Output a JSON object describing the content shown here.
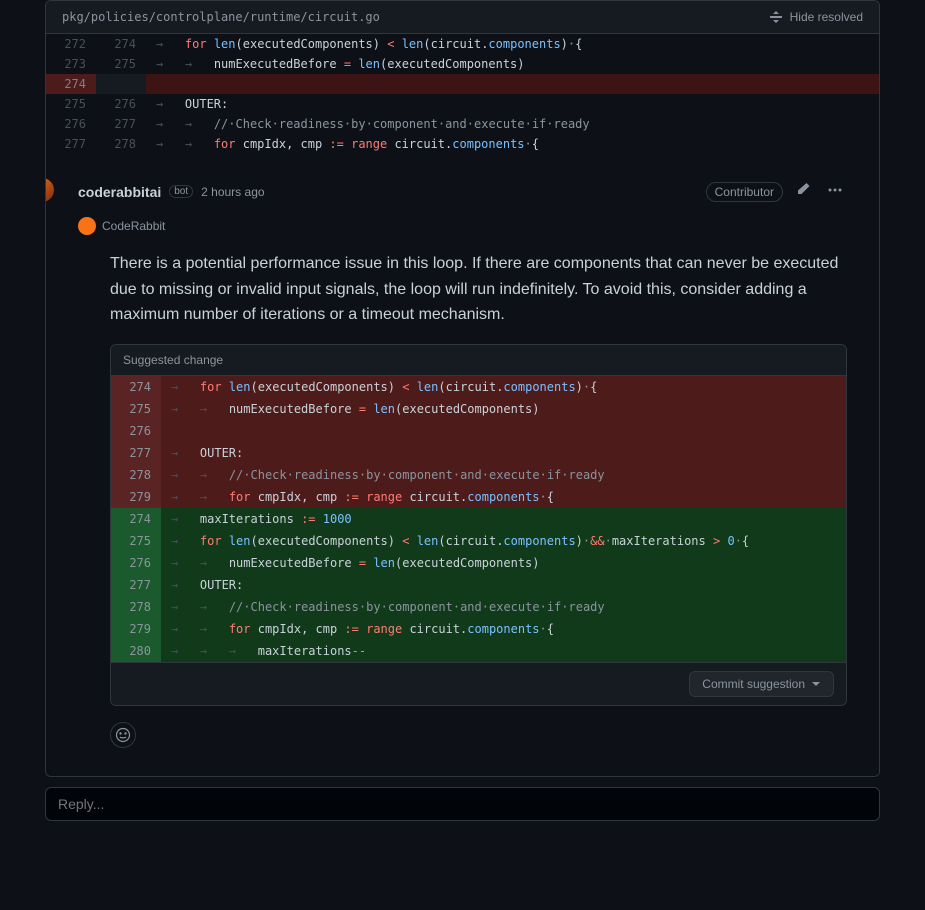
{
  "file": {
    "path": "pkg/policies/controlplane/runtime/circuit.go"
  },
  "header": {
    "hide_resolved": "Hide resolved"
  },
  "diff": [
    {
      "old": "272",
      "new": "274",
      "tokens": [
        [
          "arrow",
          "→   "
        ],
        [
          "kw",
          "for"
        ],
        [
          "",
          " "
        ],
        [
          "fn",
          "len"
        ],
        [
          "",
          "(executedComponents) "
        ],
        [
          "op",
          "<"
        ],
        [
          "",
          " "
        ],
        [
          "fn",
          "len"
        ],
        [
          "",
          "(circuit."
        ],
        [
          "field",
          "components"
        ],
        [
          "",
          ")"
        ],
        [
          "dot",
          "·"
        ],
        [
          "",
          "{"
        ]
      ]
    },
    {
      "old": "273",
      "new": "275",
      "tokens": [
        [
          "arrow",
          "→   "
        ],
        [
          "arrow",
          "→   "
        ],
        [
          "",
          "numExecutedBefore "
        ],
        [
          "op",
          "="
        ],
        [
          "",
          " "
        ],
        [
          "fn",
          "len"
        ],
        [
          "",
          "(executedComponents)"
        ]
      ]
    },
    {
      "old": "274",
      "new": "",
      "deleted": true,
      "tokens": []
    },
    {
      "old": "275",
      "new": "276",
      "tokens": [
        [
          "arrow",
          "→   "
        ],
        [
          "",
          "OUTER:"
        ]
      ]
    },
    {
      "old": "276",
      "new": "277",
      "tokens": [
        [
          "arrow",
          "→   "
        ],
        [
          "arrow",
          "→   "
        ],
        [
          "comment",
          "//"
        ],
        [
          "dot",
          "·"
        ],
        [
          "comment",
          "Check"
        ],
        [
          "dot",
          "·"
        ],
        [
          "comment",
          "readiness"
        ],
        [
          "dot",
          "·"
        ],
        [
          "comment",
          "by"
        ],
        [
          "dot",
          "·"
        ],
        [
          "comment",
          "component"
        ],
        [
          "dot",
          "·"
        ],
        [
          "comment",
          "and"
        ],
        [
          "dot",
          "·"
        ],
        [
          "comment",
          "execute"
        ],
        [
          "dot",
          "·"
        ],
        [
          "comment",
          "if"
        ],
        [
          "dot",
          "·"
        ],
        [
          "comment",
          "ready"
        ]
      ]
    },
    {
      "old": "277",
      "new": "278",
      "tokens": [
        [
          "arrow",
          "→   "
        ],
        [
          "arrow",
          "→   "
        ],
        [
          "kw",
          "for"
        ],
        [
          "",
          " cmpIdx, cmp "
        ],
        [
          "op",
          ":="
        ],
        [
          "",
          " "
        ],
        [
          "kw",
          "range"
        ],
        [
          "",
          " circuit."
        ],
        [
          "field",
          "components"
        ],
        [
          "dot",
          "·"
        ],
        [
          "",
          "{"
        ]
      ]
    }
  ],
  "comment": {
    "author": "coderabbitai",
    "bot_label": "bot",
    "time": "2 hours ago",
    "contributor": "Contributor",
    "brand": "CodeRabbit",
    "text": "There is a potential performance issue in this loop. If there are components that can never be executed due to missing or invalid input signals, the loop will run indefinitely. To avoid this, consider adding a maximum number of iterations or a timeout mechanism."
  },
  "suggestion": {
    "title": "Suggested change",
    "commit_label": "Commit suggestion",
    "del": [
      {
        "ln": "274",
        "tokens": [
          [
            "arrow",
            "→   "
          ],
          [
            "kw",
            "for"
          ],
          [
            "",
            " "
          ],
          [
            "fn",
            "len"
          ],
          [
            "",
            "(executedComponents) "
          ],
          [
            "op",
            "<"
          ],
          [
            "",
            " "
          ],
          [
            "fn",
            "len"
          ],
          [
            "",
            "(circuit."
          ],
          [
            "field",
            "components"
          ],
          [
            "",
            ")"
          ],
          [
            "dot",
            "·"
          ],
          [
            "",
            "{"
          ]
        ]
      },
      {
        "ln": "275",
        "tokens": [
          [
            "arrow",
            "→   "
          ],
          [
            "arrow",
            "→   "
          ],
          [
            "",
            "numExecutedBefore "
          ],
          [
            "op",
            "="
          ],
          [
            "",
            " "
          ],
          [
            "fn",
            "len"
          ],
          [
            "",
            "(executedComponents)"
          ]
        ]
      },
      {
        "ln": "276",
        "tokens": []
      },
      {
        "ln": "277",
        "tokens": [
          [
            "arrow",
            "→   "
          ],
          [
            "",
            "OUTER:"
          ]
        ]
      },
      {
        "ln": "278",
        "tokens": [
          [
            "arrow",
            "→   "
          ],
          [
            "arrow",
            "→   "
          ],
          [
            "comment",
            "//"
          ],
          [
            "dot",
            "·"
          ],
          [
            "comment",
            "Check"
          ],
          [
            "dot",
            "·"
          ],
          [
            "comment",
            "readiness"
          ],
          [
            "dot",
            "·"
          ],
          [
            "comment",
            "by"
          ],
          [
            "dot",
            "·"
          ],
          [
            "comment",
            "component"
          ],
          [
            "dot",
            "·"
          ],
          [
            "comment",
            "and"
          ],
          [
            "dot",
            "·"
          ],
          [
            "comment",
            "execute"
          ],
          [
            "dot",
            "·"
          ],
          [
            "comment",
            "if"
          ],
          [
            "dot",
            "·"
          ],
          [
            "comment",
            "ready"
          ]
        ]
      },
      {
        "ln": "279",
        "tokens": [
          [
            "arrow",
            "→   "
          ],
          [
            "arrow",
            "→   "
          ],
          [
            "kw",
            "for"
          ],
          [
            "",
            " cmpIdx, cmp "
          ],
          [
            "op",
            ":="
          ],
          [
            "",
            " "
          ],
          [
            "kw",
            "range"
          ],
          [
            "",
            " circuit."
          ],
          [
            "field",
            "components"
          ],
          [
            "dot",
            "·"
          ],
          [
            "",
            "{"
          ]
        ]
      }
    ],
    "add": [
      {
        "ln": "274",
        "tokens": [
          [
            "arrow",
            "→   "
          ],
          [
            "",
            "maxIterations "
          ],
          [
            "op",
            ":="
          ],
          [
            "",
            " "
          ],
          [
            "num",
            "1000"
          ]
        ]
      },
      {
        "ln": "275",
        "tokens": [
          [
            "arrow",
            "→   "
          ],
          [
            "kw",
            "for"
          ],
          [
            "",
            " "
          ],
          [
            "fn",
            "len"
          ],
          [
            "",
            "(executedComponents) "
          ],
          [
            "op",
            "<"
          ],
          [
            "",
            " "
          ],
          [
            "fn",
            "len"
          ],
          [
            "",
            "(circuit."
          ],
          [
            "field",
            "components"
          ],
          [
            "",
            ")"
          ],
          [
            "dot",
            "·"
          ],
          [
            "op",
            "&&"
          ],
          [
            "dot",
            "·"
          ],
          [
            "",
            "maxIterations "
          ],
          [
            "op",
            ">"
          ],
          [
            "",
            " "
          ],
          [
            "num",
            "0"
          ],
          [
            "dot",
            "·"
          ],
          [
            "",
            "{"
          ]
        ]
      },
      {
        "ln": "276",
        "tokens": [
          [
            "arrow",
            "→   "
          ],
          [
            "arrow",
            "→   "
          ],
          [
            "",
            "numExecutedBefore "
          ],
          [
            "op",
            "="
          ],
          [
            "",
            " "
          ],
          [
            "fn",
            "len"
          ],
          [
            "",
            "(executedComponents)"
          ]
        ]
      },
      {
        "ln": "277",
        "tokens": [
          [
            "arrow",
            "→   "
          ],
          [
            "",
            "OUTER:"
          ]
        ]
      },
      {
        "ln": "278",
        "tokens": [
          [
            "arrow",
            "→   "
          ],
          [
            "arrow",
            "→   "
          ],
          [
            "comment",
            "//"
          ],
          [
            "dot",
            "·"
          ],
          [
            "comment",
            "Check"
          ],
          [
            "dot",
            "·"
          ],
          [
            "comment",
            "readiness"
          ],
          [
            "dot",
            "·"
          ],
          [
            "comment",
            "by"
          ],
          [
            "dot",
            "·"
          ],
          [
            "comment",
            "component"
          ],
          [
            "dot",
            "·"
          ],
          [
            "comment",
            "and"
          ],
          [
            "dot",
            "·"
          ],
          [
            "comment",
            "execute"
          ],
          [
            "dot",
            "·"
          ],
          [
            "comment",
            "if"
          ],
          [
            "dot",
            "·"
          ],
          [
            "comment",
            "ready"
          ]
        ]
      },
      {
        "ln": "279",
        "tokens": [
          [
            "arrow",
            "→   "
          ],
          [
            "arrow",
            "→   "
          ],
          [
            "kw",
            "for"
          ],
          [
            "",
            " cmpIdx, cmp "
          ],
          [
            "op",
            ":="
          ],
          [
            "",
            " "
          ],
          [
            "kw",
            "range"
          ],
          [
            "",
            " circuit."
          ],
          [
            "field",
            "components"
          ],
          [
            "dot",
            "·"
          ],
          [
            "",
            "{"
          ]
        ]
      },
      {
        "ln": "280",
        "tokens": [
          [
            "arrow",
            "→   "
          ],
          [
            "arrow",
            "→   "
          ],
          [
            "arrow",
            "→   "
          ],
          [
            "",
            "maxIterations"
          ],
          [
            "op",
            "--"
          ]
        ]
      }
    ]
  },
  "reply": {
    "placeholder": "Reply..."
  }
}
